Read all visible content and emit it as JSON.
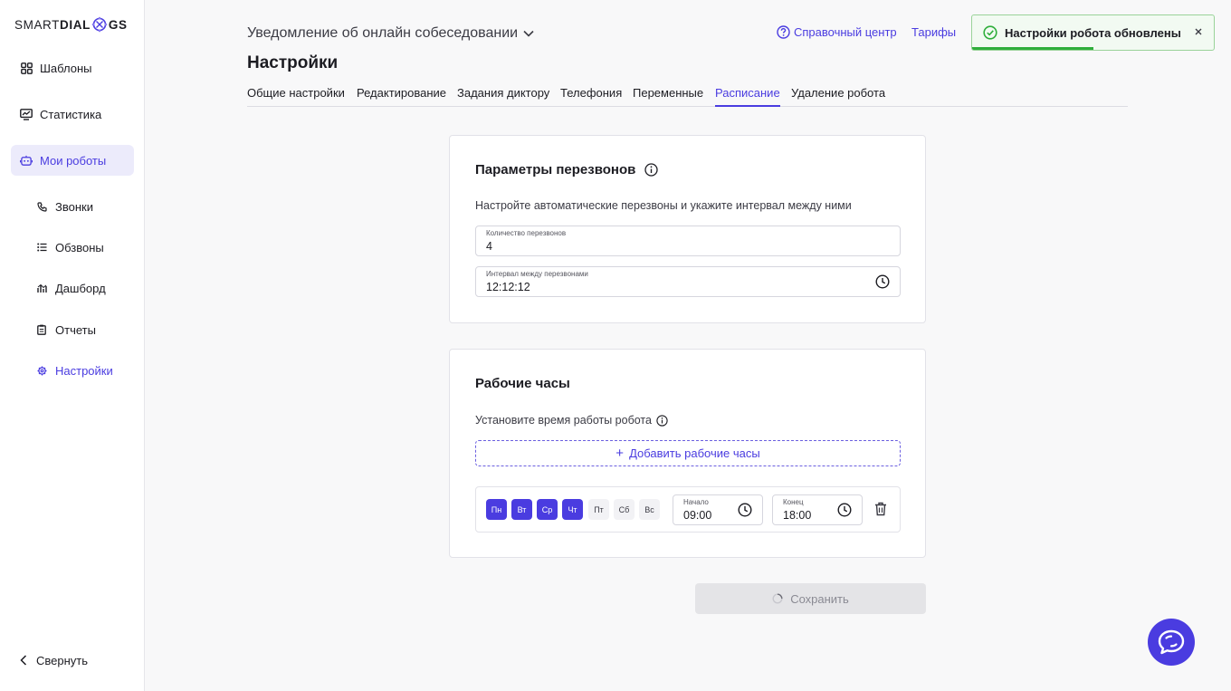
{
  "brand": {
    "logo_left": "SMART ",
    "logo_mid": "DIAL",
    "logo_right": "GS"
  },
  "sidebar": {
    "items": [
      {
        "label": "Шаблоны",
        "icon": "grid-icon"
      },
      {
        "label": "Статистика",
        "icon": "chart-monitor-icon"
      },
      {
        "label": "Мои роботы",
        "icon": "robot-icon"
      }
    ],
    "sub_items": [
      {
        "label": "Звонки",
        "icon": "phone-icon"
      },
      {
        "label": "Обзвоны",
        "icon": "list-icon"
      },
      {
        "label": "Дашборд",
        "icon": "dashboard-icon"
      },
      {
        "label": "Отчеты",
        "icon": "clipboard-icon"
      },
      {
        "label": "Настройки",
        "icon": "gear-icon"
      }
    ],
    "collapse_label": "Свернуть"
  },
  "header": {
    "robot_name": "Уведомление об онлайн собеседовании",
    "page_title": "Настройки",
    "help_center": "Справочный центр",
    "tariffs": "Тарифы"
  },
  "tabs": [
    {
      "label": "Общие настройки"
    },
    {
      "label": "Редактирование"
    },
    {
      "label": "Задания диктору"
    },
    {
      "label": "Телефония"
    },
    {
      "label": "Переменные"
    },
    {
      "label": "Расписание",
      "active": true
    },
    {
      "label": "Удаление робота"
    }
  ],
  "toast": {
    "message": "Настройки робота обновлены",
    "progress": 0.5
  },
  "redial": {
    "title": "Параметры перезвонов",
    "description": "Настройте автоматические перезвоны и укажите интервал между ними",
    "count_label": "Количество перезвонов",
    "count_value": "4",
    "interval_label": "Интервал между перезвонами",
    "interval_value": "12:12:12"
  },
  "work_hours": {
    "title": "Рабочие часы",
    "description": "Установите время работы робота",
    "add_label": "Добавить рабочие часы",
    "days": [
      {
        "label": "Пн",
        "selected": true
      },
      {
        "label": "Вт",
        "selected": true
      },
      {
        "label": "Ср",
        "selected": true
      },
      {
        "label": "Чт",
        "selected": true
      },
      {
        "label": "Пт",
        "selected": false
      },
      {
        "label": "Сб",
        "selected": false
      },
      {
        "label": "Вс",
        "selected": false
      }
    ],
    "start_label": "Начало",
    "start_value": "09:00",
    "end_label": "Конец",
    "end_value": "18:00"
  },
  "save_label": "Сохранить",
  "colors": {
    "accent": "#4a3ce0",
    "success": "#2fae3b",
    "active_bg": "#ecebfb"
  }
}
